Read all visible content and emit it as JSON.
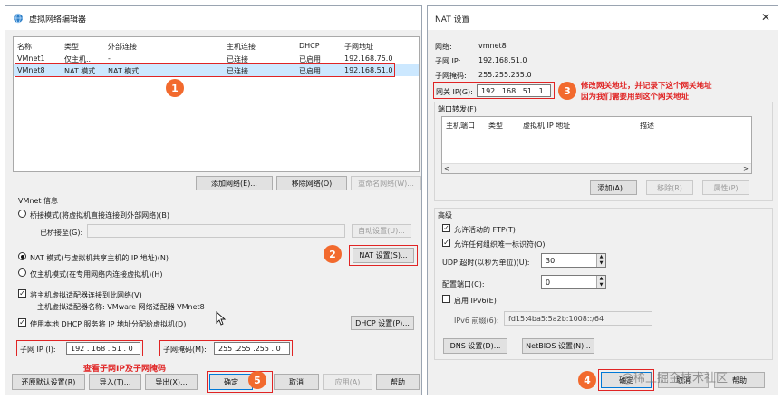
{
  "left": {
    "title": "虚拟网络编辑器",
    "table": {
      "headers": [
        "名称",
        "类型",
        "外部连接",
        "主机连接",
        "DHCP",
        "子网地址"
      ],
      "rows": [
        [
          "VMnet1",
          "仅主机...",
          "-",
          "已连接",
          "已启用",
          "192.168.75.0"
        ],
        [
          "VMnet8",
          "NAT 模式",
          "NAT 模式",
          "已连接",
          "已启用",
          "192.168.51.0"
        ]
      ]
    },
    "buttons": {
      "add": "添加网络(E)...",
      "remove": "移除网络(O)",
      "rename": "重命名网络(W)..."
    },
    "vmnet_info": "VMnet 信息",
    "bridge_mode": "桥接模式(将虚拟机直接连接到外部网络)(B)",
    "bridged_to": "已桥接至(G):",
    "auto_settings": "自动设置(U)...",
    "nat_mode": "NAT 模式(与虚拟机共享主机的 IP 地址)(N)",
    "nat_settings": "NAT 设置(S)...",
    "host_only": "仅主机模式(在专用网络内连接虚拟机)(H)",
    "connect_adapter": "将主机虚拟适配器连接到此网络(V)",
    "adapter_name": "主机虚拟适配器名称: VMware 网络适配器 VMnet8",
    "use_dhcp": "使用本地 DHCP 服务将 IP 地址分配给虚拟机(D)",
    "dhcp_settings": "DHCP 设置(P)...",
    "subnet_ip_label": "子网 IP (I):",
    "subnet_ip": "192 . 168 . 51 . 0",
    "subnet_mask_label": "子网掩码(M):",
    "subnet_mask": "255 .255 .255 . 0",
    "footer": {
      "restore": "还原默认设置(R)",
      "import": "导入(T)...",
      "export": "导出(X)...",
      "ok": "确定",
      "cancel": "取消",
      "apply": "应用(A)",
      "help": "帮助"
    }
  },
  "right": {
    "title": "NAT 设置",
    "network_label": "网络:",
    "network_value": "vmnet8",
    "subnet_ip_label": "子网 IP:",
    "subnet_ip_value": "192.168.51.0",
    "subnet_mask_label": "子网掩码:",
    "subnet_mask_value": "255.255.255.0",
    "gateway_label": "网关 IP(G):",
    "gateway_value": "192 . 168 . 51 . 1",
    "port_forwarding": "端口转发(F)",
    "pf_headers": [
      "主机端口",
      "类型",
      "虚拟机 IP 地址",
      "描述"
    ],
    "pf_buttons": {
      "add": "添加(A)...",
      "remove": "移除(R)",
      "props": "属性(P)"
    },
    "advanced": "高级",
    "allow_ftp": "允许活动的 FTP(T)",
    "allow_oui": "允许任何组织唯一标识符(O)",
    "udp_timeout_label": "UDP 超时(以秒为单位)(U):",
    "udp_timeout": "30",
    "config_port_label": "配置端口(C):",
    "config_port": "0",
    "enable_ipv6": "启用 IPv6(E)",
    "ipv6_prefix_label": "IPv6 前缀(6):",
    "ipv6_prefix": "fd15:4ba5:5a2b:1008::/64",
    "dns_settings": "DNS 设置(D)...",
    "netbios_settings": "NetBIOS 设置(N)...",
    "ok": "确定",
    "cancel": "取消",
    "help": "帮助"
  },
  "annotations": {
    "b1": "1",
    "b2": "2",
    "b3": "3",
    "b4": "4",
    "b5": "5",
    "gateway_note_1": "修改网关地址，并记录下这个网关地址",
    "gateway_note_2": "因为我们需要用到这个网关地址",
    "subnet_note": "查看子网IP及子网掩码"
  },
  "watermark": "@稀土掘金技术社区",
  "colors": {
    "annotation_red": "#e02424",
    "badge_orange": "#f26a2e",
    "selection_blue": "#cce8ff"
  }
}
